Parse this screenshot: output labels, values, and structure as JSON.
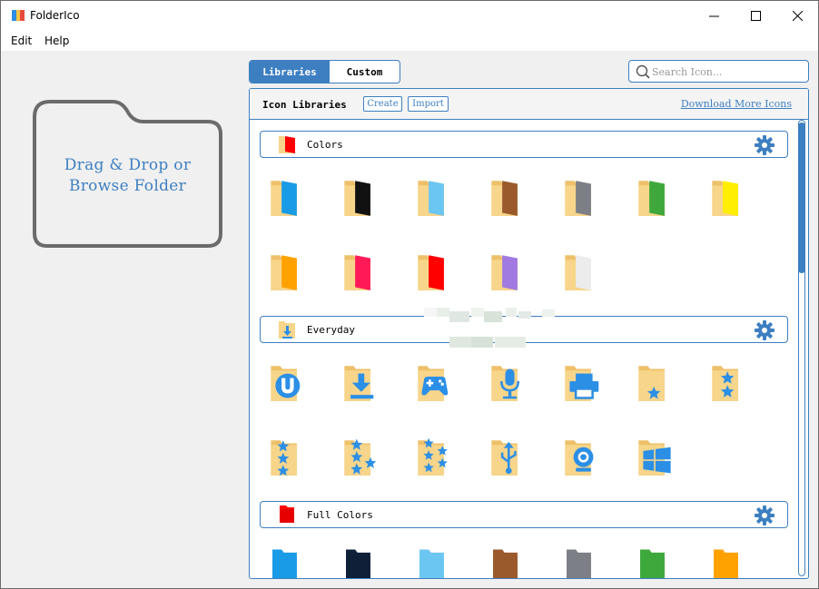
{
  "window": {
    "title": "FolderIco"
  },
  "menu": {
    "items": [
      "Edit",
      "Help"
    ]
  },
  "dropzone": {
    "line1": "Drag & Drop or",
    "line2": "Browse Folder"
  },
  "tabs": {
    "libraries": "Libraries",
    "custom": "Custom",
    "active": "Libraries"
  },
  "search": {
    "placeholder": "Search Icon...",
    "value": ""
  },
  "panel": {
    "title": "Icon Libraries",
    "create_label": "Create",
    "import_label": "Import",
    "download_link": "Download More Icons"
  },
  "sections": [
    {
      "label": "Colors",
      "icon": "red-folder-icon",
      "folders": [
        {
          "name": "blue",
          "color": "#1a9be6"
        },
        {
          "name": "black",
          "color": "#111111"
        },
        {
          "name": "light-blue",
          "color": "#6cc6f2"
        },
        {
          "name": "brown",
          "color": "#9a5a2c"
        },
        {
          "name": "gray",
          "color": "#7d7f86"
        },
        {
          "name": "green",
          "color": "#3ea83d"
        },
        {
          "name": "yellow",
          "color": "#ffee00"
        },
        {
          "name": "orange",
          "color": "#ffa200"
        },
        {
          "name": "pink",
          "color": "#ff1a57"
        },
        {
          "name": "red",
          "color": "#ff0000"
        },
        {
          "name": "purple",
          "color": "#a07ae0"
        },
        {
          "name": "white",
          "color": "#ececec"
        }
      ]
    },
    {
      "label": "Everyday",
      "icon": "download-folder-icon",
      "folders": [
        {
          "name": "utorrent",
          "glyph": "utorrent-icon"
        },
        {
          "name": "download",
          "glyph": "download-icon"
        },
        {
          "name": "gamepad",
          "glyph": "gamepad-icon"
        },
        {
          "name": "microphone",
          "glyph": "microphone-icon"
        },
        {
          "name": "printer",
          "glyph": "printer-icon"
        },
        {
          "name": "star-1",
          "glyph": "star-icon"
        },
        {
          "name": "stars-2",
          "glyph": "two-stars-icon"
        },
        {
          "name": "stars-3",
          "glyph": "three-stars-icon"
        },
        {
          "name": "stars-4",
          "glyph": "four-stars-icon"
        },
        {
          "name": "stars-5",
          "glyph": "five-stars-icon"
        },
        {
          "name": "usb",
          "glyph": "usb-icon"
        },
        {
          "name": "webcam",
          "glyph": "webcam-icon"
        },
        {
          "name": "windows",
          "glyph": "windows-icon"
        }
      ]
    },
    {
      "label": "Full Colors",
      "icon": "full-red-folder-icon",
      "folders": [
        {
          "name": "full-blue",
          "color": "#1a9be6"
        },
        {
          "name": "full-navy",
          "color": "#0f2038"
        },
        {
          "name": "full-light-blue",
          "color": "#6cc6f2"
        },
        {
          "name": "full-brown",
          "color": "#9a5a2c"
        },
        {
          "name": "full-gray",
          "color": "#7d7f86"
        },
        {
          "name": "full-green",
          "color": "#3ea83d"
        },
        {
          "name": "full-orange",
          "color": "#ffa200"
        }
      ]
    }
  ],
  "colors": {
    "accent": "#3d7fc1",
    "folder": "#f7d58a",
    "glyph": "#2b8fe6"
  }
}
